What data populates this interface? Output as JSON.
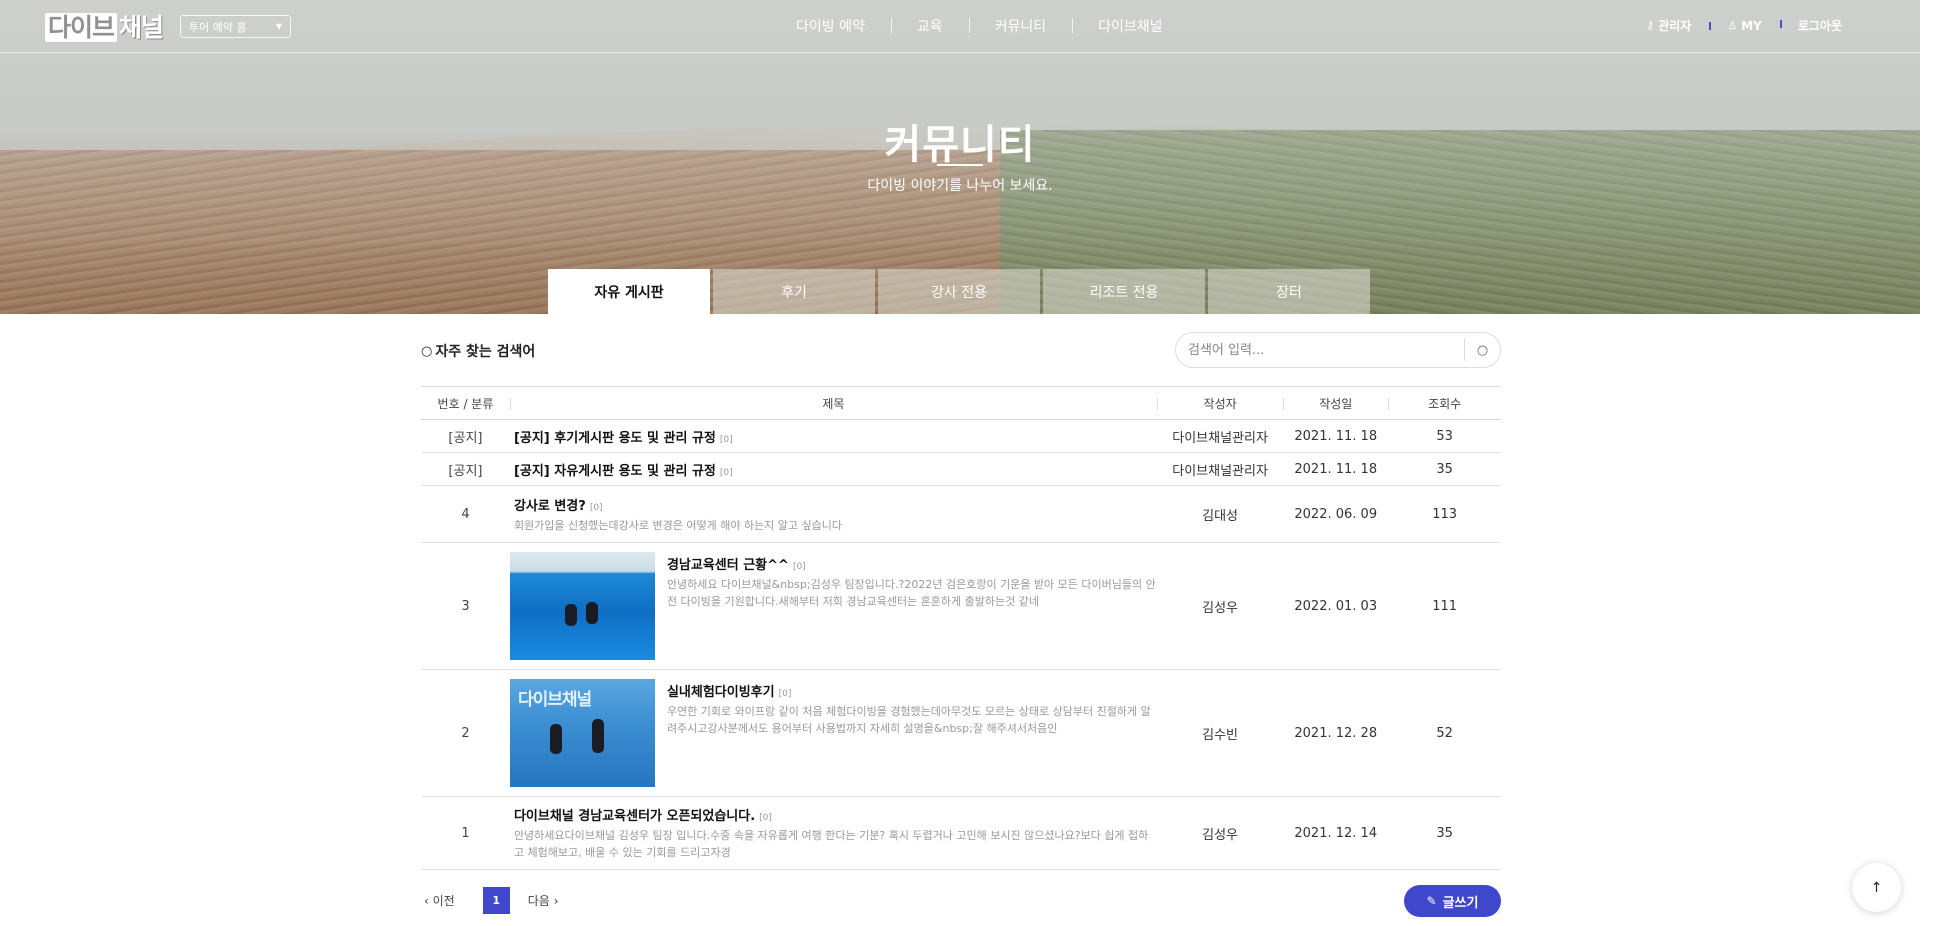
{
  "header": {
    "logo_text_a": "다이브",
    "logo_text_b": "채널",
    "tour_select": {
      "selected": "투어 예약 홈"
    },
    "nav": [
      "다이빙 예약",
      "교육",
      "커뮤니티",
      "다이브채널"
    ],
    "util": {
      "admin": "관리자",
      "my": "MY",
      "logout": "로그아웃"
    }
  },
  "hero": {
    "title": "커뮤니티",
    "subtitle": "다이빙 이야기를 나누어 보세요."
  },
  "tabs": [
    "자유 게시판",
    "후기",
    "강사 전용",
    "리조트 전용",
    "장터"
  ],
  "search": {
    "label": "자주 찾는 검색어",
    "placeholder": "검색어 입력..."
  },
  "table": {
    "headers": [
      "번호 / 분류",
      "제목",
      "작성자",
      "작성일",
      "조회수"
    ],
    "rows": [
      {
        "num": "[공지]",
        "title": "[공지] 후기게시판 용도 및 관리 규정",
        "count": "[0]",
        "excerpt": "",
        "author": "다이브채널관리자",
        "date": "2021. 11. 18",
        "views": "53"
      },
      {
        "num": "[공지]",
        "title": "[공지] 자유게시판 용도 및 관리 규정",
        "count": "[0]",
        "excerpt": "",
        "author": "다이브채널관리자",
        "date": "2021. 11. 18",
        "views": "35"
      },
      {
        "num": "4",
        "title": "강사로 변경?",
        "count": "[0]",
        "excerpt": "회원가입을 신청했는데강사로 변경은 어떻게 해야 하는지 알고 싶습니다",
        "author": "김대성",
        "date": "2022. 06. 09",
        "views": "113"
      },
      {
        "num": "3",
        "title": "경남교육센터 근황^^",
        "count": "[0]",
        "excerpt": "안녕하세요 다이브채널&nbsp;김성우 팀장입니다.?2022년 검은호랑이 기운을 받아 모든 다이버님들의 안전 다이빙을 기원합니다.새해부터 저희 경남교육센터는 혼훈하게 출발하는것 같네",
        "author": "김성우",
        "date": "2022. 01. 03",
        "views": "111"
      },
      {
        "num": "2",
        "title": "실내체험다이빙후기",
        "count": "[0]",
        "excerpt": "우연한 기회로 와이프랑 같이 처음 체험다이빙을 경험했는데아무것도 모르는 상태로 상담부터 친절하게 알려주시고강사분께서도 용어부터 사용법까지 자세히 설명을&nbsp;잘 해주셔서처음인",
        "author": "김수빈",
        "date": "2021. 12. 28",
        "views": "52"
      },
      {
        "num": "1",
        "title": "다이브채널 경남교육센터가 오픈되었습니다.",
        "count": "[0]",
        "excerpt": "안녕하세요다이브채널 김성우 팀장 입니다.수중 속을 자유롭게 여행 한다는 기분? 혹시 두렵거나 고민해 보시진 않으셨나요?보다 쉽게 접하고 체험해보고, 배울 수 있는 기회를 드리고자경",
        "author": "김성우",
        "date": "2021. 12. 14",
        "views": "35"
      }
    ]
  },
  "pagination": {
    "prev": "이전",
    "current": "1",
    "next": "다음"
  },
  "write_button": "글쓰기",
  "colors": {
    "accent": "#3f48cc"
  }
}
